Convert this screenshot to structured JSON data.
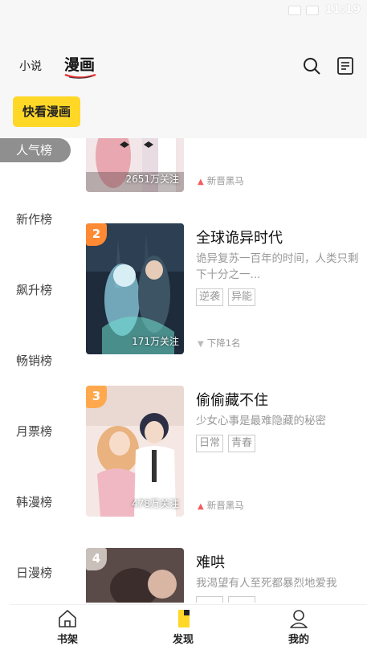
{
  "status_bar": {
    "time": "11:19"
  },
  "header": {
    "tabs": [
      {
        "label": "小说"
      },
      {
        "label": "漫画"
      }
    ]
  },
  "badge": {
    "label": "快看漫画",
    "color": "#ffd726"
  },
  "sidebar": {
    "items": [
      {
        "label": "人气榜",
        "active": true
      },
      {
        "label": "新作榜"
      },
      {
        "label": "飙升榜"
      },
      {
        "label": "畅销榜"
      },
      {
        "label": "月票榜"
      },
      {
        "label": "韩漫榜"
      },
      {
        "label": "日漫榜"
      }
    ]
  },
  "comics": [
    {
      "rank": "",
      "title": "",
      "desc": "",
      "tags": [
        "",
        ""
      ],
      "follows": "2651万关注",
      "trend": "新晋黑马",
      "trend_type": "new"
    },
    {
      "rank": "2",
      "title": "全球诡异时代",
      "desc": "诡异复苏一百年的时间，人类只剩下十分之一...",
      "tags": [
        "逆袭",
        "异能"
      ],
      "follows": "171万关注",
      "trend": "下降1名",
      "trend_type": "down"
    },
    {
      "rank": "3",
      "title": "偷偷藏不住",
      "desc": "少女心事是最难隐藏的秘密",
      "tags": [
        "日常",
        "青春"
      ],
      "follows": "478万关注",
      "trend": "新晋黑马",
      "trend_type": "new"
    },
    {
      "rank": "4",
      "title": "难哄",
      "desc": "我渴望有人至死都暴烈地爱我",
      "tags": [
        "",
        ""
      ],
      "follows": "",
      "trend": "",
      "trend_type": ""
    }
  ],
  "bottom_nav": {
    "items": [
      {
        "label": "书架",
        "icon": "house-icon"
      },
      {
        "label": "发现",
        "icon": "bookmark-icon"
      },
      {
        "label": "我的",
        "icon": "person-icon"
      }
    ]
  }
}
